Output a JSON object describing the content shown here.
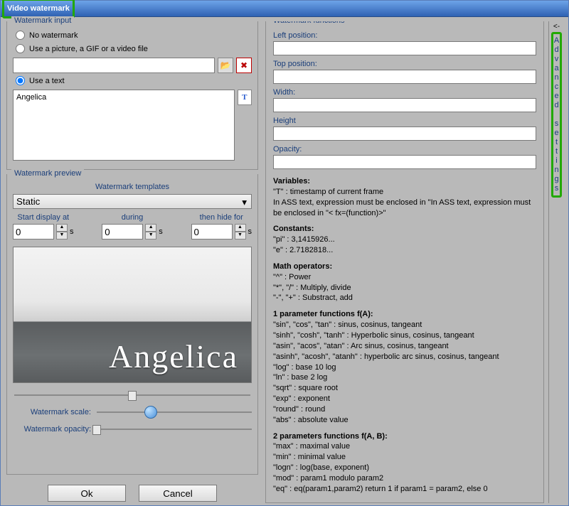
{
  "window": {
    "title": "Video watermark"
  },
  "watermark_input": {
    "group_title": "Watermark input",
    "no_watermark": "No watermark",
    "use_picture": "Use a picture, a GIF or a video file",
    "use_text": "Use a text",
    "picture_path": "",
    "text_value": "Angelica",
    "selected": "text"
  },
  "preview": {
    "group_title": "Watermark preview",
    "templates_label": "Watermark templates",
    "template_selected": "Static",
    "start_label": "Start display at",
    "during_label": "during",
    "hide_label": "then hide for",
    "unit": "s",
    "start_value": "0",
    "during_value": "0",
    "hide_value": "0",
    "watermark_text": "Angelica",
    "scale_label": "Watermark scale:",
    "opacity_label": "Watermark opacity:"
  },
  "buttons": {
    "ok": "Ok",
    "cancel": "Cancel"
  },
  "functions": {
    "group_title": "Watermark functions",
    "left_label": "Left position:",
    "top_label": "Top position:",
    "width_label": "Width:",
    "height_label": "Height",
    "opacity_label": "Opacity:",
    "left": "",
    "top": "",
    "width": "",
    "height": "",
    "opacity": ""
  },
  "doc": {
    "variables_h": "Variables:",
    "var_t": "\"T\"   : timestamp of current frame",
    "var_note": "In ASS text, expression must be enclosed in \"In ASS text, expression must be enclosed in \"< fx=(function)>\"",
    "constants_h": "Constants:",
    "pi": "\"pi\"  : 3,1415926...",
    "e": "\"e\"   : 2.7182818...",
    "math_h": "Math operators:",
    "op1": "\"^\"     : Power",
    "op2": "\"*\", \"/\" : Multiply, divide",
    "op3": "\"-\", \"+\" : Substract, add",
    "f1_h": "1 parameter functions f(A):",
    "f1a": "\"sin\", \"cos\", \"tan\"   : sinus, cosinus, tangeant",
    "f1b": "\"sinh\", \"cosh\", \"tanh\" : Hyperbolic sinus, cosinus, tangeant",
    "f1c": "\"asin\", \"acos\", \"atan\"  : Arc sinus, cosinus, tangeant",
    "f1d": "\"asinh\", \"acosh\", \"atanh\" : hyperbolic arc sinus, cosinus, tangeant",
    "f1e": "\"log\"   : base 10 log",
    "f1f": "\"ln\"    : base 2 log",
    "f1g": "\"sqrt\"  : square root",
    "f1h": "\"exp\"   : exponent",
    "f1i": "\"round\" : round",
    "f1j": "\"abs\"   : absolute value",
    "f2_h": "2 parameters functions f(A, B):",
    "f2a": "\"max\"  : maximal value",
    "f2b": "\"min\"  : minimal value",
    "f2c": "\"logn\" : log(base, exponent)",
    "f2d": "\"mod\"  : param1 modulo param2",
    "f2e": "\"eq\"   : eq(param1,param2) return 1 if param1 = param2, else 0"
  },
  "advanced": {
    "arrow": "<-",
    "label": "Advanced settings"
  }
}
